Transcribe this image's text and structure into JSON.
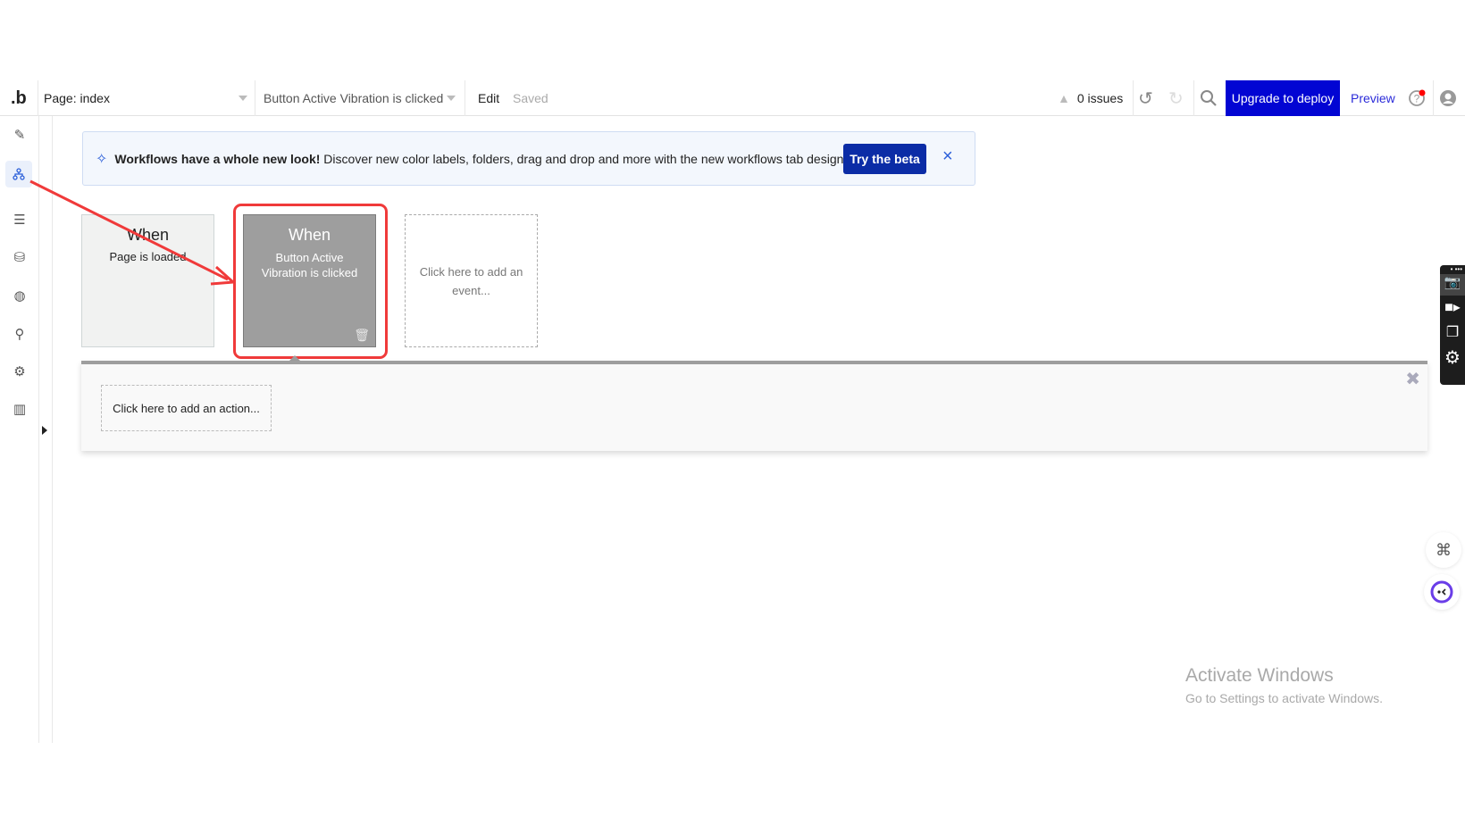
{
  "topbar": {
    "logo": ".b",
    "page_selector": "Page: index",
    "workflow_selector": "Button Active Vibration is clicked",
    "edit": "Edit",
    "saved": "Saved",
    "issues": "0 issues",
    "upgrade": "Upgrade to deploy",
    "preview": "Preview"
  },
  "sidebar": {
    "items": [
      {
        "icon": "pencil-icon",
        "label": "Design"
      },
      {
        "icon": "workflow-icon",
        "label": "Workflow",
        "active": true
      },
      {
        "icon": "data-icon",
        "label": "Data"
      },
      {
        "icon": "database-icon",
        "label": "Database"
      },
      {
        "icon": "palette-icon",
        "label": "Styles"
      },
      {
        "icon": "plugin-icon",
        "label": "Plugins"
      },
      {
        "icon": "gear-icon",
        "label": "Settings"
      },
      {
        "icon": "chart-icon",
        "label": "Logs"
      }
    ]
  },
  "banner": {
    "bold": "Workflows have a whole new look!",
    "text": " Discover new color labels, folders, drag and drop and more with the new workflows tab design.",
    "button": "Try the beta"
  },
  "events": [
    {
      "title": "When",
      "subtitle": "Page is loaded"
    },
    {
      "title": "When",
      "subtitle": "Button Active Vibration is clicked",
      "selected": true
    }
  ],
  "add_event": "Click here to add an event...",
  "add_action": "Click here to add an action...",
  "watermark": {
    "title": "Activate Windows",
    "subtitle": "Go to Settings to activate Windows."
  },
  "colors": {
    "accent": "#0205D3",
    "annotation": "#F03A3A",
    "selected_card": "#9E9E9E"
  }
}
